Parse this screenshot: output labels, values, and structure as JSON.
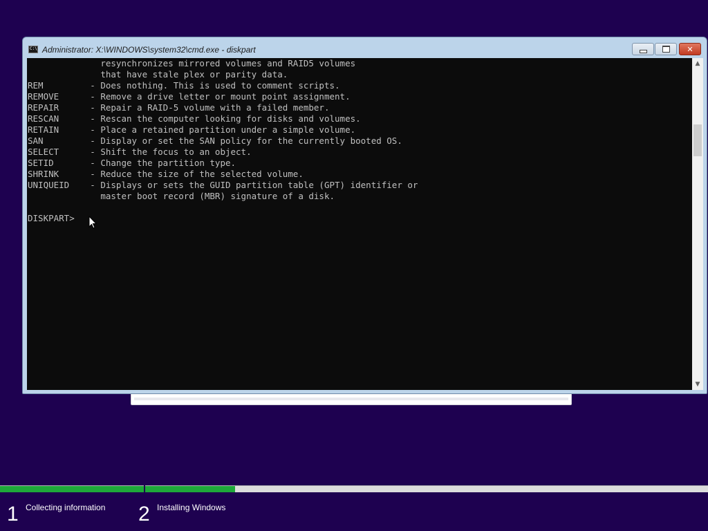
{
  "window": {
    "title": "Administrator: X:\\WINDOWS\\system32\\cmd.exe - diskpart",
    "icon_text": "C:\\",
    "minimize_glyph": "minimize-icon",
    "maximize_glyph": "maximize-icon",
    "close_label": "✕"
  },
  "console": {
    "lines": [
      "              resynchronizes mirrored volumes and RAID5 volumes",
      "              that have stale plex or parity data.",
      "REM         - Does nothing. This is used to comment scripts.",
      "REMOVE      - Remove a drive letter or mount point assignment.",
      "REPAIR      - Repair a RAID-5 volume with a failed member.",
      "RESCAN      - Rescan the computer looking for disks and volumes.",
      "RETAIN      - Place a retained partition under a simple volume.",
      "SAN         - Display or set the SAN policy for the currently booted OS.",
      "SELECT      - Shift the focus to an object.",
      "SETID       - Change the partition type.",
      "SHRINK      - Reduce the size of the selected volume.",
      "UNIQUEID    - Displays or sets the GUID partition table (GPT) identifier or",
      "              master boot record (MBR) signature of a disk.",
      "",
      "DISKPART> "
    ]
  },
  "scrollbar": {
    "up_arrow": "▲",
    "down_arrow": "▼"
  },
  "setup": {
    "progress": [
      1.0,
      0.16
    ],
    "steps": [
      {
        "number": "1",
        "label": "Collecting information"
      },
      {
        "number": "2",
        "label": "Installing Windows"
      }
    ]
  },
  "colors": {
    "background": "#1e0150",
    "console_bg": "#0c0c0c",
    "console_text": "#c0c0c0",
    "progress_green": "#1ea83a"
  }
}
